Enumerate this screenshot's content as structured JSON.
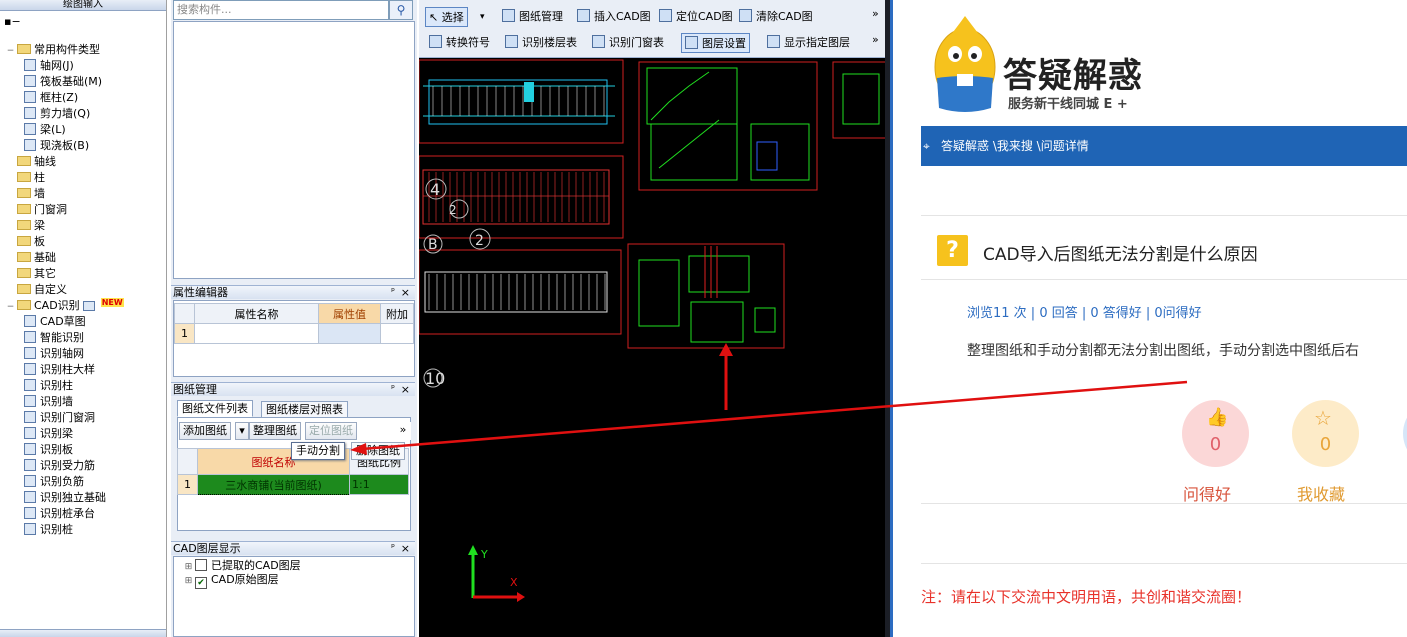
{
  "tree": {
    "header": "绘图输入",
    "root": "常用构件类型",
    "common_items": [
      "轴网(J)",
      "筏板基础(M)",
      "框柱(Z)",
      "剪力墙(Q)",
      "梁(L)",
      "现浇板(B)"
    ],
    "folders": [
      "轴线",
      "柱",
      "墙",
      "门窗洞",
      "梁",
      "板",
      "基础",
      "其它",
      "自定义"
    ],
    "cad_folder": "CAD识别",
    "new_badge": "NEW",
    "cad_items": [
      "CAD草图",
      "智能识别",
      "识别轴网",
      "识别柱大样",
      "识别柱",
      "识别墙",
      "识别门窗洞",
      "识别梁",
      "识别板",
      "识别受力筋",
      "识别负筋",
      "识别独立基础",
      "识别桩承台",
      "识别桩"
    ]
  },
  "mid": {
    "search_placeholder": "搜索构件...",
    "prop_editor": {
      "title": "属性编辑器",
      "col_name": "属性名称",
      "col_value": "属性值",
      "col_extra": "附加",
      "row1": "1"
    },
    "drawing_mgmt": {
      "title": "图纸管理",
      "tab1": "图纸文件列表",
      "tab2": "图纸楼层对照表",
      "btn_add": "添加图纸",
      "btn_arrange": "整理图纸",
      "btn_locate": "定位图纸",
      "popup_manual": "手动分割",
      "popup_delete": "删除图纸",
      "col_name": "图纸名称",
      "col_scale": "图纸比例",
      "row_num": "1",
      "row_name": "三水商铺(当前图纸)",
      "row_scale": "1:1"
    },
    "cad_layers": {
      "title": "CAD图层显示",
      "item1": "已提取的CAD图层",
      "item2": "CAD原始图层"
    },
    "pin": "ᵖ",
    "close": "×"
  },
  "cad_toolbar": {
    "row1": [
      "选择",
      "图纸管理",
      "插入CAD图",
      "定位CAD图",
      "清除CAD图"
    ],
    "row2": [
      "转换符号",
      "识别楼层表",
      "识别门窗表",
      "图层设置",
      "显示指定图层"
    ],
    "more": "»"
  },
  "cad_canvas": {
    "labels": [
      "4",
      "2",
      "B",
      "2",
      "10"
    ],
    "axis_y": "Y",
    "axis_x": "X"
  },
  "web": {
    "logo_title": "答疑解惑",
    "logo_sub": "服务新干线同城 E +",
    "breadcrumb": "答疑解惑 \\我来搜 \\问题详情",
    "question_title": "CAD导入后图纸无法分割是什么原因",
    "stats": "浏览11 次 | 0 回答 | 0 答得好 | 0问得好",
    "description": "整理图纸和手动分割都无法分割出图纸，手动分割选中图纸后右",
    "like_count": "0",
    "like_label": "问得好",
    "fav_count": "0",
    "fav_label": "我收藏",
    "note": "注：请在以下交流中文明用语，共创和谐交流圈！",
    "colors": {
      "nav": "#1f64b5",
      "like": "#fbd7d7",
      "fav": "#fdebc8",
      "accent_red": "#e8322a"
    }
  }
}
